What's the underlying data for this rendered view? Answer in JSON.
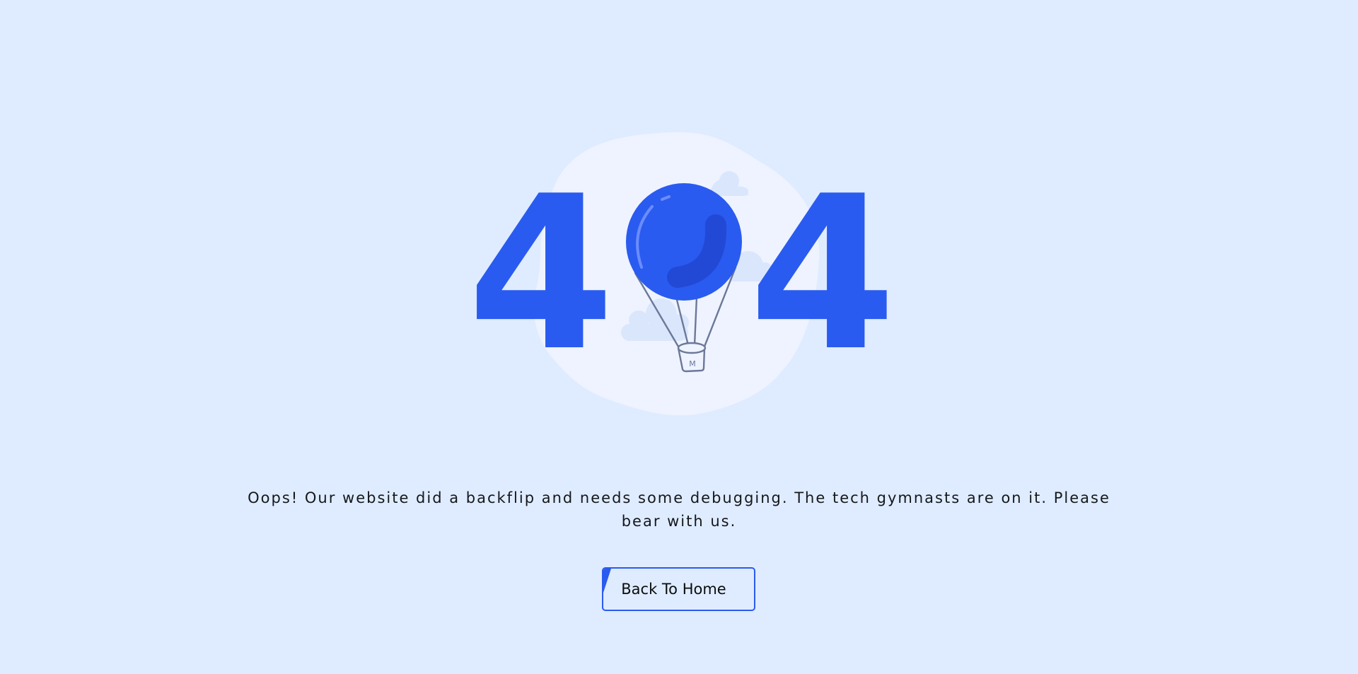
{
  "hero": {
    "digit_left": "4",
    "digit_right": "4",
    "balloon_icon": "hot-air-balloon-icon",
    "basket_mark": "M"
  },
  "message": {
    "text": "Oops! Our website did a backflip and needs some debugging. The tech gymnasts are on it. Please bear with us."
  },
  "button": {
    "label": "Back To Home"
  },
  "colors": {
    "background": "#dfecff",
    "accent": "#2a5bf0",
    "blob": "#eef3ff",
    "cloud": "#dae6fc",
    "rope": "#6b7898",
    "text": "#15171c"
  }
}
